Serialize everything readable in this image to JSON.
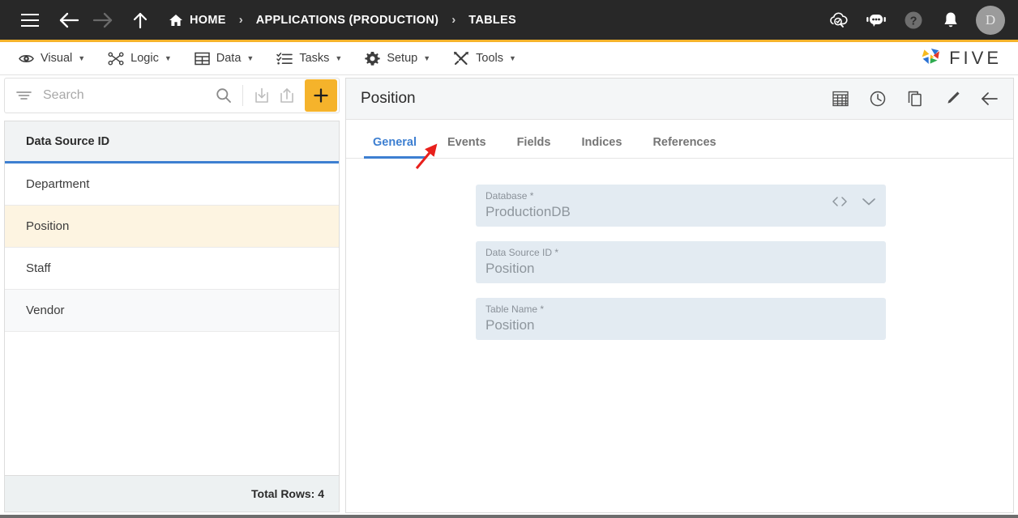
{
  "topbar": {
    "menu_icon": "hamburger-icon",
    "back_icon": "arrow-left-icon",
    "forward_icon": "arrow-right-icon",
    "up_icon": "arrow-up-icon",
    "breadcrumbs": [
      {
        "label": "HOME",
        "icon": "home-icon"
      },
      {
        "label": "APPLICATIONS (PRODUCTION)",
        "icon": ""
      },
      {
        "label": "TABLES",
        "icon": ""
      }
    ],
    "separator": "›",
    "actions": [
      {
        "name": "cloud-search-icon"
      },
      {
        "name": "chat-bot-icon"
      },
      {
        "name": "help-icon"
      },
      {
        "name": "notifications-bell-icon"
      }
    ],
    "avatar_initial": "D",
    "accent_color": "#F5B32B",
    "background_color": "#282828"
  },
  "menubar": {
    "items": [
      {
        "label": "Visual",
        "icon": "eye-icon",
        "caret": "▼"
      },
      {
        "label": "Logic",
        "icon": "logic-nodes-icon",
        "caret": "▼"
      },
      {
        "label": "Data",
        "icon": "table-grid-icon",
        "caret": "▼"
      },
      {
        "label": "Tasks",
        "icon": "checklist-icon",
        "caret": "▼"
      },
      {
        "label": "Setup",
        "icon": "gear-icon",
        "caret": "▼"
      },
      {
        "label": "Tools",
        "icon": "tools-wrench-icon",
        "caret": "▼"
      }
    ],
    "brand": "FIVE"
  },
  "sidebar": {
    "search": {
      "placeholder": "Search",
      "value": "",
      "filter_icon": "filter-icon",
      "search_icon": "search-icon",
      "import_icon": "import-icon",
      "export_icon": "export-icon",
      "add_label": "+"
    },
    "column_header": "Data Source ID",
    "rows": [
      {
        "label": "Department",
        "selected": false
      },
      {
        "label": "Position",
        "selected": true
      },
      {
        "label": "Staff",
        "selected": false
      },
      {
        "label": "Vendor",
        "selected": false
      }
    ],
    "footer": "Total Rows: 4",
    "selected_row_color": "#fdf4e1",
    "header_underline_color": "#3d7fd1"
  },
  "detail": {
    "title": "Position",
    "header_icons": [
      {
        "name": "table-grid-icon"
      },
      {
        "name": "history-clock-icon"
      },
      {
        "name": "duplicate-icon"
      },
      {
        "name": "edit-pencil-icon"
      },
      {
        "name": "back-arrow-icon"
      }
    ],
    "tabs": [
      {
        "label": "General",
        "active": true
      },
      {
        "label": "Events",
        "active": false
      },
      {
        "label": "Fields",
        "active": false
      },
      {
        "label": "Indices",
        "active": false
      },
      {
        "label": "References",
        "active": false
      }
    ],
    "active_tab_color": "#3d7fd1",
    "fields": [
      {
        "label": "Database *",
        "value": "ProductionDB",
        "icons": [
          "code-brackets-icon",
          "chevron-down-icon"
        ]
      },
      {
        "label": "Data Source ID *",
        "value": "Position",
        "icons": []
      },
      {
        "label": "Table Name *",
        "value": "Position",
        "icons": []
      }
    ]
  },
  "annotation": {
    "type": "arrow",
    "color": "#e8201c",
    "points_to": "Events"
  }
}
